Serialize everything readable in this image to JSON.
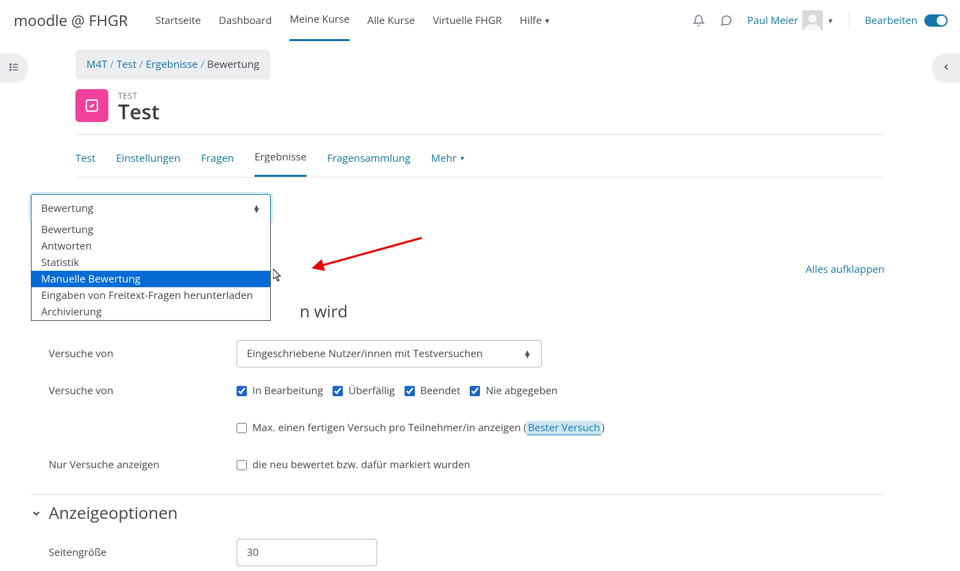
{
  "brand": "moodle @ FHGR",
  "nav": {
    "start": "Startseite",
    "dashboard": "Dashboard",
    "my_courses": "Meine Kurse",
    "all_courses": "Alle Kurse",
    "virtual": "Virtuelle FHGR",
    "help": "Hilfe"
  },
  "user": {
    "name": "Paul Meier"
  },
  "edit_mode": "Bearbeiten",
  "breadcrumb": {
    "c0": "M4T",
    "c1": "Test",
    "c2": "Ergebnisse",
    "c3": "Bewertung"
  },
  "title": {
    "eyebrow": "TEST",
    "main": "Test"
  },
  "tabs": {
    "test": "Test",
    "einstellungen": "Einstellungen",
    "fragen": "Fragen",
    "ergebnisse": "Ergebnisse",
    "sammlung": "Fragensammlung",
    "mehr": "Mehr"
  },
  "expand_all": "Alles aufklappen",
  "report_select": {
    "value": "Bewertung",
    "options": [
      "Bewertung",
      "Antworten",
      "Statistik",
      "Manuelle Bewertung",
      "Eingaben von Freitext-Fragen herunterladen",
      "Archivierung"
    ]
  },
  "section_partial": "n wird",
  "attempts_from_label": "Versuche von",
  "attempts_from_value": "Eingeschriebene Nutzer/innen mit Testversuchen",
  "attempts_state_label": "Versuche von",
  "states": {
    "inprogress": "In Bearbeitung",
    "overdue": "Überfällig",
    "finished": "Beendet",
    "notgiven": "Nie abgegeben"
  },
  "max_one": {
    "pre": "Max. einen fertigen Versuch pro Teilnehmer/in anzeigen (",
    "link": "Bester Versuch",
    "post": ")"
  },
  "only_show_label": "Nur Versuche anzeigen",
  "only_show_text": "die neu bewertet bzw. dafür markiert wurden",
  "display_section": "Anzeigeoptionen",
  "page_size_label": "Seitengröße",
  "page_size_value": "30"
}
